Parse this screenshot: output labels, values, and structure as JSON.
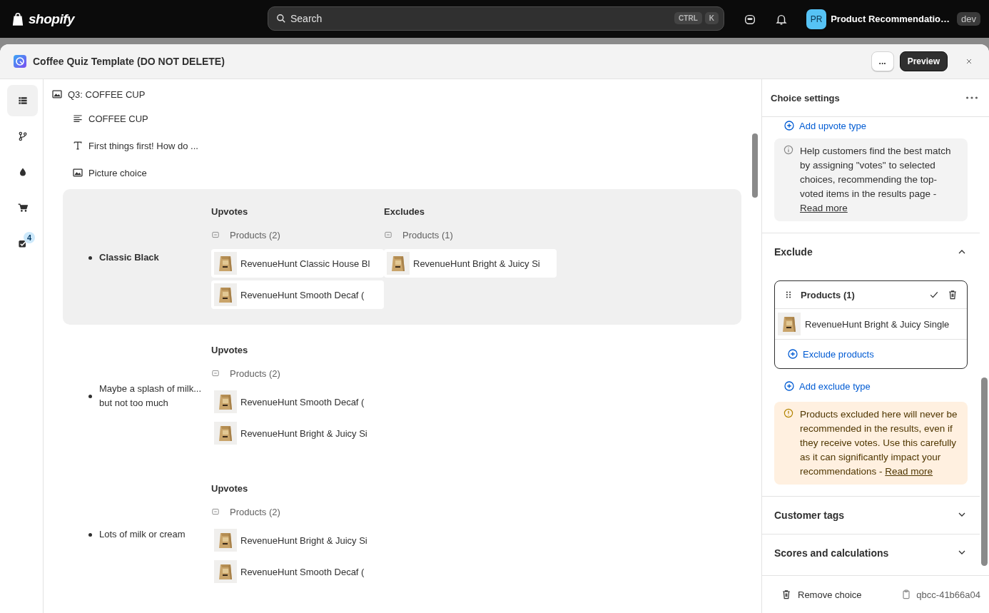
{
  "topbar": {
    "brand": "shopify",
    "search": {
      "placeholder": "Search",
      "shortcut": [
        "CTRL",
        "K"
      ]
    },
    "store": {
      "initials": "PR",
      "name": "Product Recommendatio…",
      "badge": "dev"
    }
  },
  "modal": {
    "title": "Coffee Quiz Template (DO NOT DELETE)",
    "buttons": [
      {
        "label": "...",
        "kind": "secondary"
      },
      {
        "label": "Preview",
        "kind": "primary"
      }
    ]
  },
  "rail": [
    {
      "kind": "list",
      "selected": true
    },
    {
      "kind": "branch",
      "selected": false
    },
    {
      "kind": "drop",
      "selected": false
    },
    {
      "kind": "cart",
      "selected": false
    },
    {
      "kind": "checklist",
      "selected": false,
      "badge": "4"
    }
  ],
  "tree": {
    "title": "Q3: COFFEE CUP",
    "children": [
      {
        "kind": "heading",
        "label": "COFFEE CUP"
      },
      {
        "kind": "text",
        "label": "First things first! How do ..."
      },
      {
        "kind": "picture",
        "label": "Picture choice"
      }
    ]
  },
  "choices": [
    {
      "label": "Classic Black",
      "selected": true,
      "groups": [
        {
          "title": "Upvotes",
          "label": "Products (2)",
          "products": [
            "RevenueHunt Classic House Bl",
            "RevenueHunt Smooth Decaf ("
          ]
        },
        {
          "title": "Excludes",
          "label": "Products (1)",
          "products": [
            "RevenueHunt Bright & Juicy Si"
          ]
        }
      ]
    },
    {
      "label": "Maybe a splash of milk... but not too much",
      "selected": false,
      "groups": [
        {
          "title": "Upvotes",
          "label": "Products (2)",
          "products": [
            "RevenueHunt Smooth Decaf (",
            "RevenueHunt Bright & Juicy Si"
          ]
        }
      ]
    },
    {
      "label": "Lots of milk or cream",
      "selected": false,
      "groups": [
        {
          "title": "Upvotes",
          "label": "Products (2)",
          "products": [
            "RevenueHunt Bright & Juicy Si",
            "RevenueHunt Smooth Decaf ("
          ]
        }
      ]
    }
  ],
  "settings": {
    "title": "Choice settings",
    "add_upvote": "Add upvote type",
    "info": "Help customers find the best match by assigning \"votes\" to selected choices, recommending the top-voted items in the results page - ",
    "info_link": "Read more",
    "exclude": {
      "title": "Exclude",
      "expanded": true,
      "group": {
        "label": "Products (1)",
        "products": [
          "RevenueHunt Bright & Juicy Single"
        ],
        "action": "Exclude products"
      },
      "add": "Add exclude type",
      "warning": "Products excluded here will never be recommended in the results, even if they receive votes. Use this carefully as it can significantly impact your recommendations - ",
      "warning_link": "Read more"
    },
    "sections": [
      {
        "title": "Customer tags",
        "expanded": false
      },
      {
        "title": "Scores and calculations",
        "expanded": false
      }
    ],
    "footer": {
      "remove": "Remove choice",
      "id": "qbcc-41b66a04"
    }
  }
}
